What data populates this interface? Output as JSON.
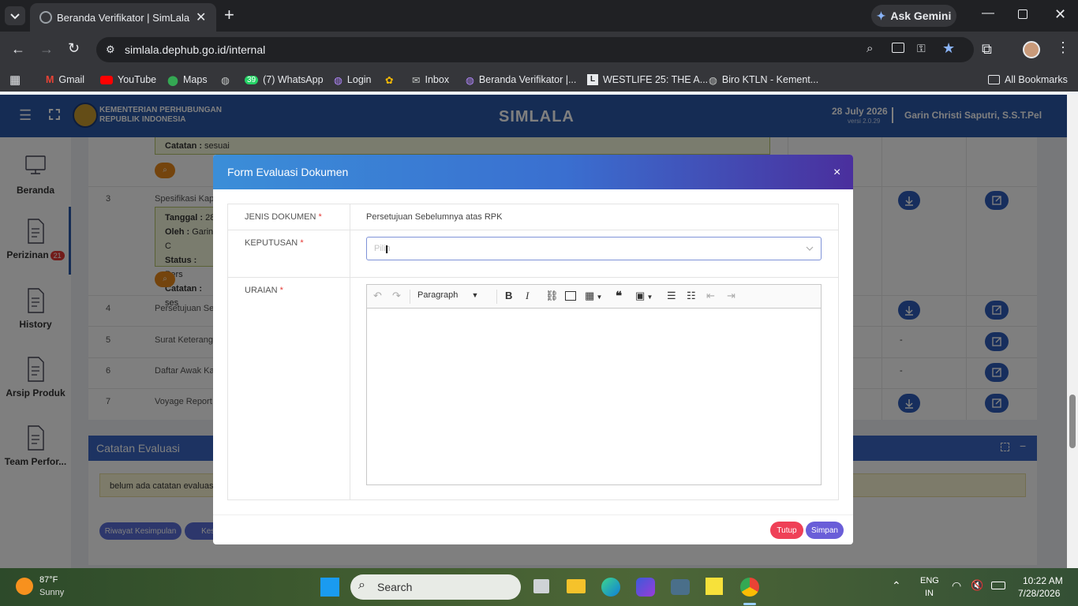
{
  "browser": {
    "tab_title": "Beranda Verifikator | SimLala",
    "ask_gemini": "Ask Gemini",
    "url": "simlala.dephub.go.id/internal",
    "bookmarks": [
      {
        "label": "Gmail"
      },
      {
        "label": "YouTube"
      },
      {
        "label": "Maps"
      },
      {
        "label": ""
      },
      {
        "label": "(7) WhatsApp",
        "badge": "39"
      },
      {
        "label": "Login"
      },
      {
        "label": ""
      },
      {
        "label": "Inbox"
      },
      {
        "label": "Beranda Verifikator |..."
      },
      {
        "label": "WESTLIFE 25: THE A..."
      },
      {
        "label": "Biro KTLN - Kement..."
      }
    ],
    "all_bookmarks": "All Bookmarks"
  },
  "app": {
    "org_line1": "KEMENTERIAN PERHUBUNGAN",
    "org_line2": "REPUBLIK INDONESIA",
    "title": "SIMLALA",
    "date": "28 July 2026",
    "version": "versi 2.0.29",
    "user": "Garin Christi Saputri, S.S.T.Pel"
  },
  "sidebar": {
    "items": [
      {
        "label": "Beranda",
        "icon": "monitor-icon"
      },
      {
        "label": "Perizinan",
        "icon": "document-icon",
        "badge": "21"
      },
      {
        "label": "History",
        "icon": "document-icon"
      },
      {
        "label": "Arsip Produk",
        "icon": "document-icon"
      },
      {
        "label": "Team Perfor...",
        "icon": "document-icon"
      }
    ]
  },
  "background_table": {
    "top_note_label": "Catatan :",
    "top_note_value": "sesuai",
    "row3": {
      "no": "3",
      "name": "Spesifikasi Kapa",
      "tanggal_label": "Tanggal :",
      "tanggal_value": "28",
      "oleh_label": "Oleh :",
      "oleh_value": "Garin C",
      "status_label": "Status :",
      "status_value": "Pers",
      "catatan_label": "Catatan :",
      "catatan_value": "ses"
    },
    "rows": [
      {
        "no": "4",
        "name": "Persetujuan Seb",
        "download": "yes",
        "dash": ""
      },
      {
        "no": "5",
        "name": "Surat Keteranga",
        "download": "",
        "dash": "-"
      },
      {
        "no": "6",
        "name": "Daftar Awak Kap",
        "download": "",
        "dash": "-"
      },
      {
        "no": "7",
        "name": "Voyage Report (",
        "download": "yes",
        "dash": ""
      }
    ]
  },
  "catatan_panel": {
    "title": "Catatan Evaluasi",
    "empty_text": "belum ada catatan evaluasi",
    "btn_riwayat": "Riwayat Kesimpulan",
    "btn_kesim": "Kesim"
  },
  "modal": {
    "title": "Form Evaluasi Dokumen",
    "close": "×",
    "jenis_label": "JENIS DOKUMEN",
    "jenis_value": "Persetujuan Sebelumnya atas RPK",
    "keputusan_label": "KEPUTUSAN",
    "keputusan_placeholder": "Pilih",
    "uraian_label": "URAIAN",
    "required_mark": "*",
    "editor_paragraph": "Paragraph",
    "btn_tutup": "Tutup",
    "btn_simpan": "Simpan"
  },
  "taskbar": {
    "temp": "87°F",
    "weather": "Sunny",
    "search_placeholder": "Search",
    "lang1": "ENG",
    "lang2": "IN",
    "time": "10:22 AM",
    "date": "7/28/2026"
  },
  "colors": {
    "header_blue": "#2b58a8",
    "modal_gradient_start": "#3b8ed8",
    "modal_gradient_end": "#4a2f9d",
    "tutup": "#ef4057",
    "simpan": "#6a5ed8",
    "action_blue": "#2f5dba"
  }
}
